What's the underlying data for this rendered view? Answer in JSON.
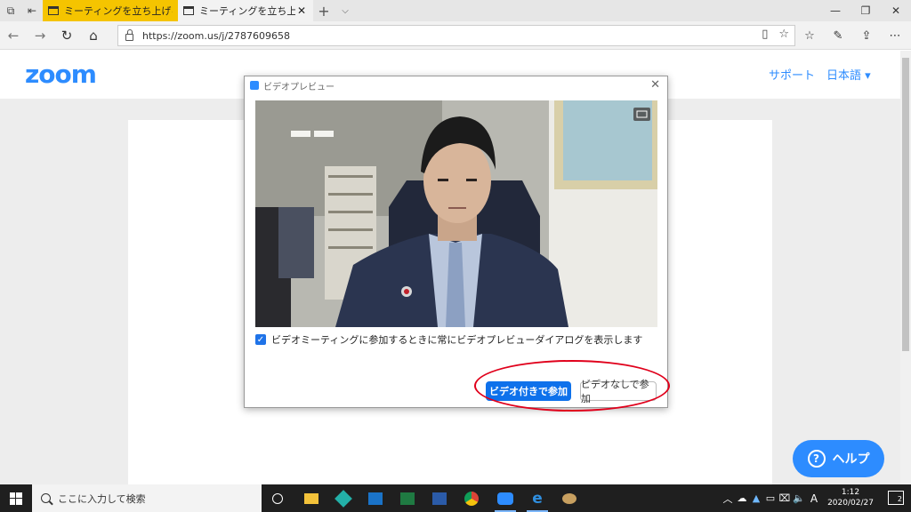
{
  "browser": {
    "tabs": [
      {
        "label": "ミーティングを立ち上げる - Zoom",
        "active": true
      },
      {
        "label": "ミーティングを立ち上げる - Zoom",
        "active": false
      }
    ],
    "url": "https://zoom.us/j/2787609658"
  },
  "site": {
    "logo": "zoom",
    "nav": {
      "support": "サポート",
      "language": "日本語 ▾"
    },
    "help_button": "ヘルプ",
    "help_icon_glyph": "?"
  },
  "dialog": {
    "title": "ビデオプレビュー",
    "checkbox_label": "ビデオミーティングに参加するときに常にビデオプレビューダイアログを表示します",
    "checkbox_checked": true,
    "join_with_video": "ビデオ付きで参加",
    "join_without_video": "ビデオなしで参加"
  },
  "taskbar": {
    "search_placeholder": "ここに入力して検索",
    "time": "1:12",
    "date": "2020/02/27",
    "ime": "A",
    "notification_count": "2"
  },
  "colors": {
    "accent": "#2d8cff",
    "join_button": "#0e71eb",
    "active_tab": "#f5c400",
    "annotation": "#e0001b"
  }
}
